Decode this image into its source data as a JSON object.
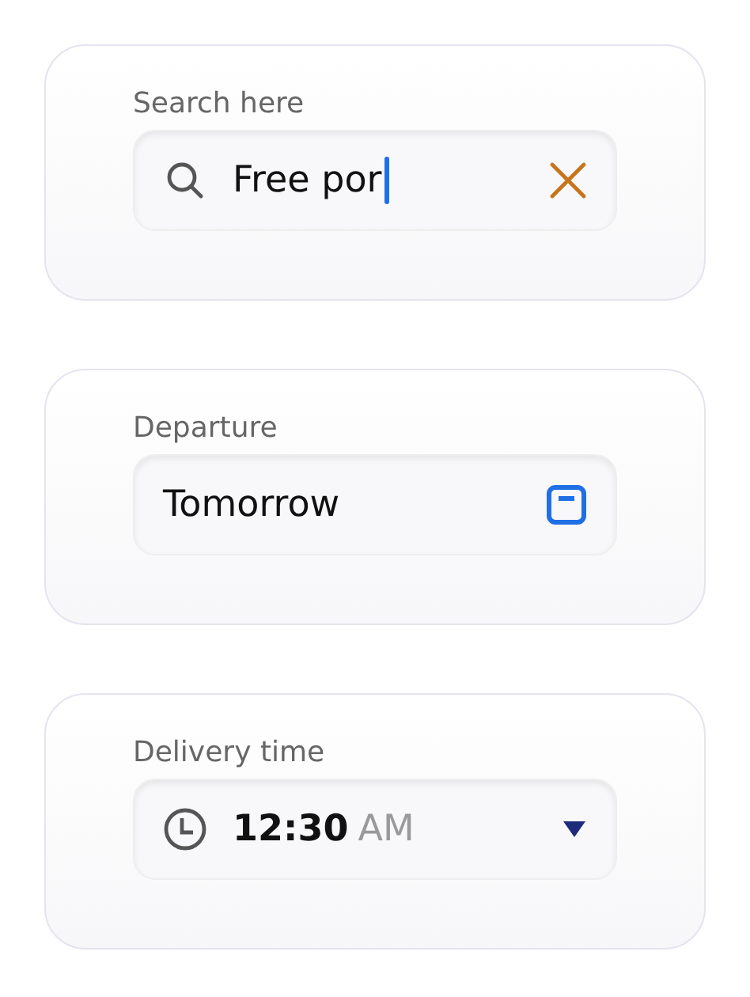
{
  "cards": [
    {
      "kind": "search",
      "label": "Search here",
      "value": "Free por",
      "focused": true
    },
    {
      "kind": "date",
      "label": "Departure",
      "value": "Tomorrow"
    },
    {
      "kind": "time",
      "label": "Delivery time",
      "value": "12:30",
      "period": "AM"
    }
  ]
}
